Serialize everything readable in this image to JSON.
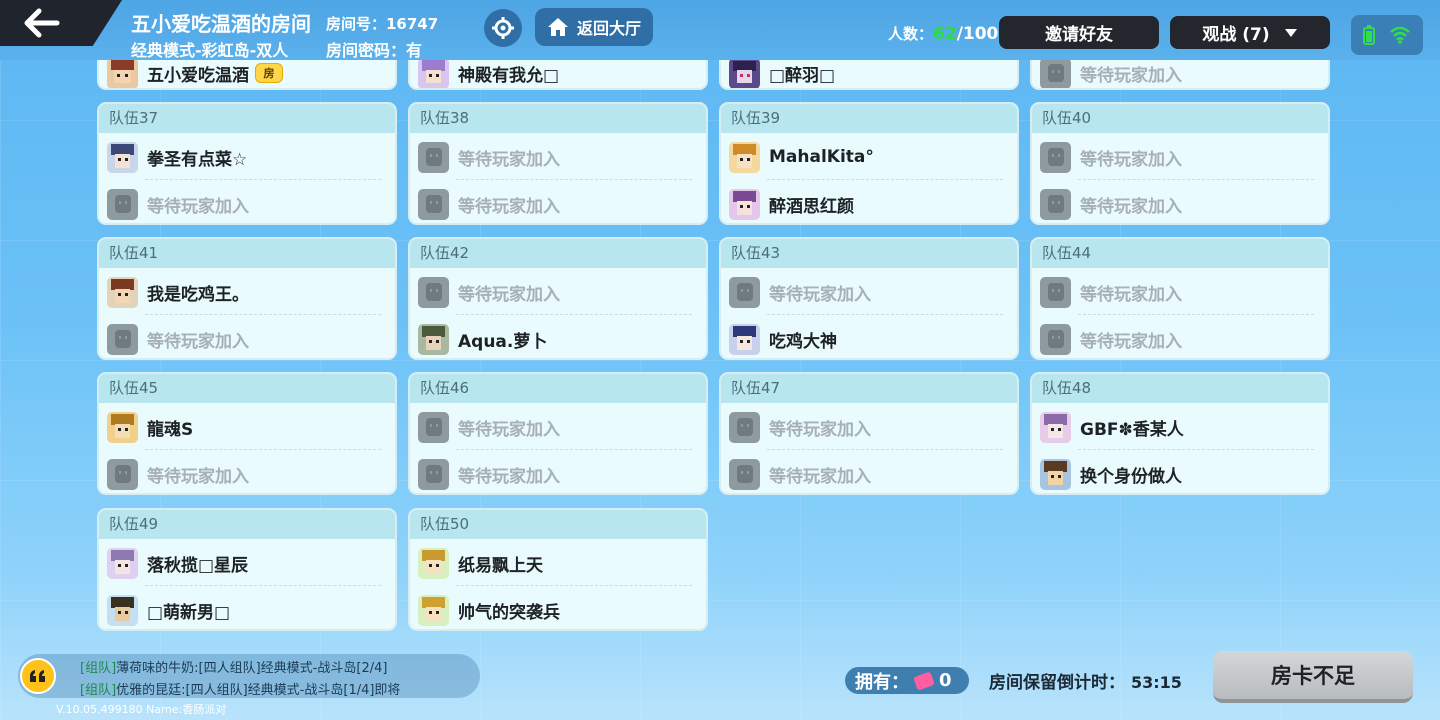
{
  "header": {
    "room_title": "五小爱吃温酒的房间",
    "room_number": "房间号：16747",
    "mode": "经典模式-彩虹岛-双人",
    "password": "房间密码：有",
    "lobby_button": "返回大厅",
    "count_label": "人数：",
    "count_current": "62",
    "count_max": "/100",
    "invite_button": "邀请好友",
    "spectate_button": "观战 (7)"
  },
  "teams_partial": [
    {
      "p1": "五小爱吃温酒",
      "host_badge": "房"
    },
    {
      "p1": "神殿有我允□"
    },
    {
      "p1": "□醉羽□"
    },
    {
      "p1": "等待玩家加入"
    }
  ],
  "teams": [
    {
      "name": "队伍37",
      "p1": "拳圣有点菜☆",
      "p2": "等待玩家加入"
    },
    {
      "name": "队伍38",
      "p1": "等待玩家加入",
      "p2": "等待玩家加入"
    },
    {
      "name": "队伍39",
      "p1": "MahalKita°",
      "p2": "醉酒思红颜"
    },
    {
      "name": "队伍40",
      "p1": "等待玩家加入",
      "p2": "等待玩家加入"
    },
    {
      "name": "队伍41",
      "p1": "我是吃鸡王。",
      "p2": "等待玩家加入"
    },
    {
      "name": "队伍42",
      "p1": "等待玩家加入",
      "p2": "Aqua.萝卜"
    },
    {
      "name": "队伍43",
      "p1": "等待玩家加入",
      "p2": "吃鸡大神"
    },
    {
      "name": "队伍44",
      "p1": "等待玩家加入",
      "p2": "等待玩家加入"
    },
    {
      "name": "队伍45",
      "p1": "龍魂S",
      "p2": "等待玩家加入"
    },
    {
      "name": "队伍46",
      "p1": "等待玩家加入",
      "p2": "等待玩家加入"
    },
    {
      "name": "队伍47",
      "p1": "等待玩家加入",
      "p2": "等待玩家加入"
    },
    {
      "name": "队伍48",
      "p1": "GBF✽香某人",
      "p2": "换个身份做人"
    },
    {
      "name": "队伍49",
      "p1": "落秋揽□星辰",
      "p2": "□萌新男□"
    },
    {
      "name": "队伍50",
      "p1": "纸易飘上天",
      "p2": "帅气的突袭兵"
    }
  ],
  "chat": {
    "line1_tag": "[组队]",
    "line1_text": "薄荷味的牛奶:[四人组队]经典模式-战斗岛[2/4]",
    "line2_tag": "[组队]",
    "line2_text": "优雅的昆廷:[四人组队]经典模式-战斗岛[1/4]即将"
  },
  "version": "V.10.05.499180 Name:香肠派对",
  "own_label": "拥有：",
  "own_count": "0",
  "timer_label": "房间保留倒计时：",
  "timer_value": "53:15",
  "action_button": "房卡不足"
}
